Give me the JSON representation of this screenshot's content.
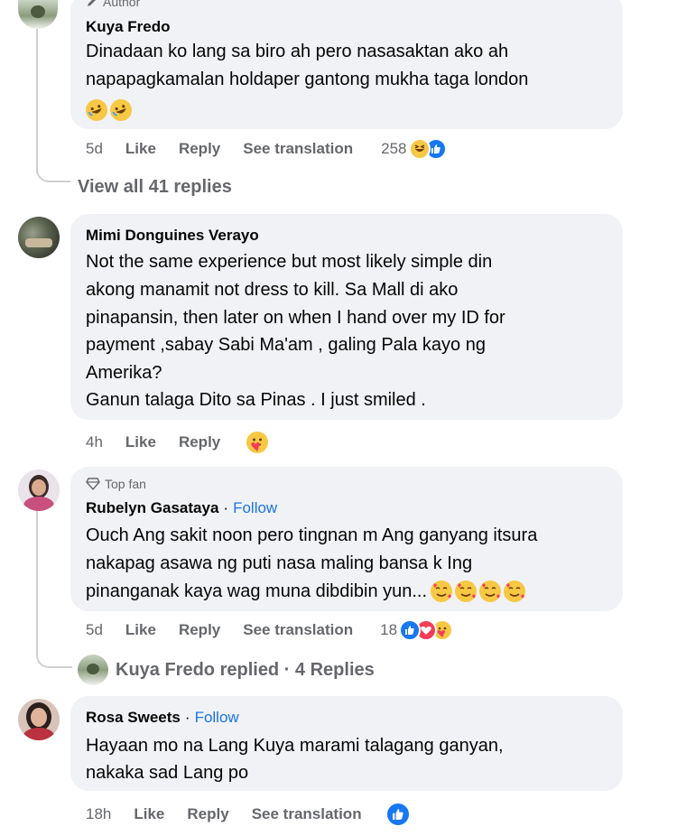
{
  "comment1": {
    "badge": "Author",
    "author": "Kuya Fredo",
    "text_line1": "Dinadaan ko lang sa biro ah pero nasasaktan ako ah",
    "text_line2": "napapagkamalan holdaper gantong mukha taga london",
    "time": "5d",
    "like": "Like",
    "reply": "Reply",
    "see_translation": "See translation",
    "reaction_count": "258"
  },
  "view_all_replies": "View all 41 replies",
  "comment2": {
    "author": "Mimi Donguines Verayo",
    "lines": [
      "Not the same experience but most likely simple din",
      "akong manamit not dress to kill. Sa Mall di ako",
      "pinapansin, then later on when I hand over my ID for",
      "payment ,sabay Sabi Ma'am , galing Pala kayo ng",
      "Amerika?",
      "Ganun talaga Dito sa Pinas . I just smiled ."
    ],
    "time": "4h",
    "like": "Like",
    "reply": "Reply"
  },
  "comment3": {
    "badge": "Top fan",
    "author": "Rubelyn Gasataya",
    "separator": "·",
    "follow": "Follow",
    "lines": [
      "Ouch Ang sakit noon pero tingnan m Ang ganyang itsura",
      "nakapag asawa ng puti nasa maling bansa k Ing",
      "pinanganak kaya wag muna dibdibin yun..."
    ],
    "time": "5d",
    "like": "Like",
    "reply": "Reply",
    "see_translation": "See translation",
    "reaction_count": "18"
  },
  "reply_summary": "Kuya Fredo replied · 4 Replies",
  "comment4": {
    "author": "Rosa Sweets",
    "separator": "·",
    "follow": "Follow",
    "lines": [
      "Hayaan mo na Lang Kuya marami talagang ganyan,",
      "nakaka sad Lang po"
    ],
    "time": "18h",
    "like": "Like",
    "reply": "Reply",
    "see_translation": "See translation"
  },
  "colors": {
    "bubble": "#f0f2f5",
    "secondary_text": "#65676b",
    "link_blue": "#1b74e4",
    "like_blue": "#1877f2"
  },
  "icons": [
    "pen-icon",
    "diamond-icon",
    "like-reaction-icon",
    "haha-reaction-icon",
    "love-reaction-icon",
    "care-reaction-icon",
    "rofl-emoji-icon",
    "smiling-hearts-emoji-icon"
  ]
}
